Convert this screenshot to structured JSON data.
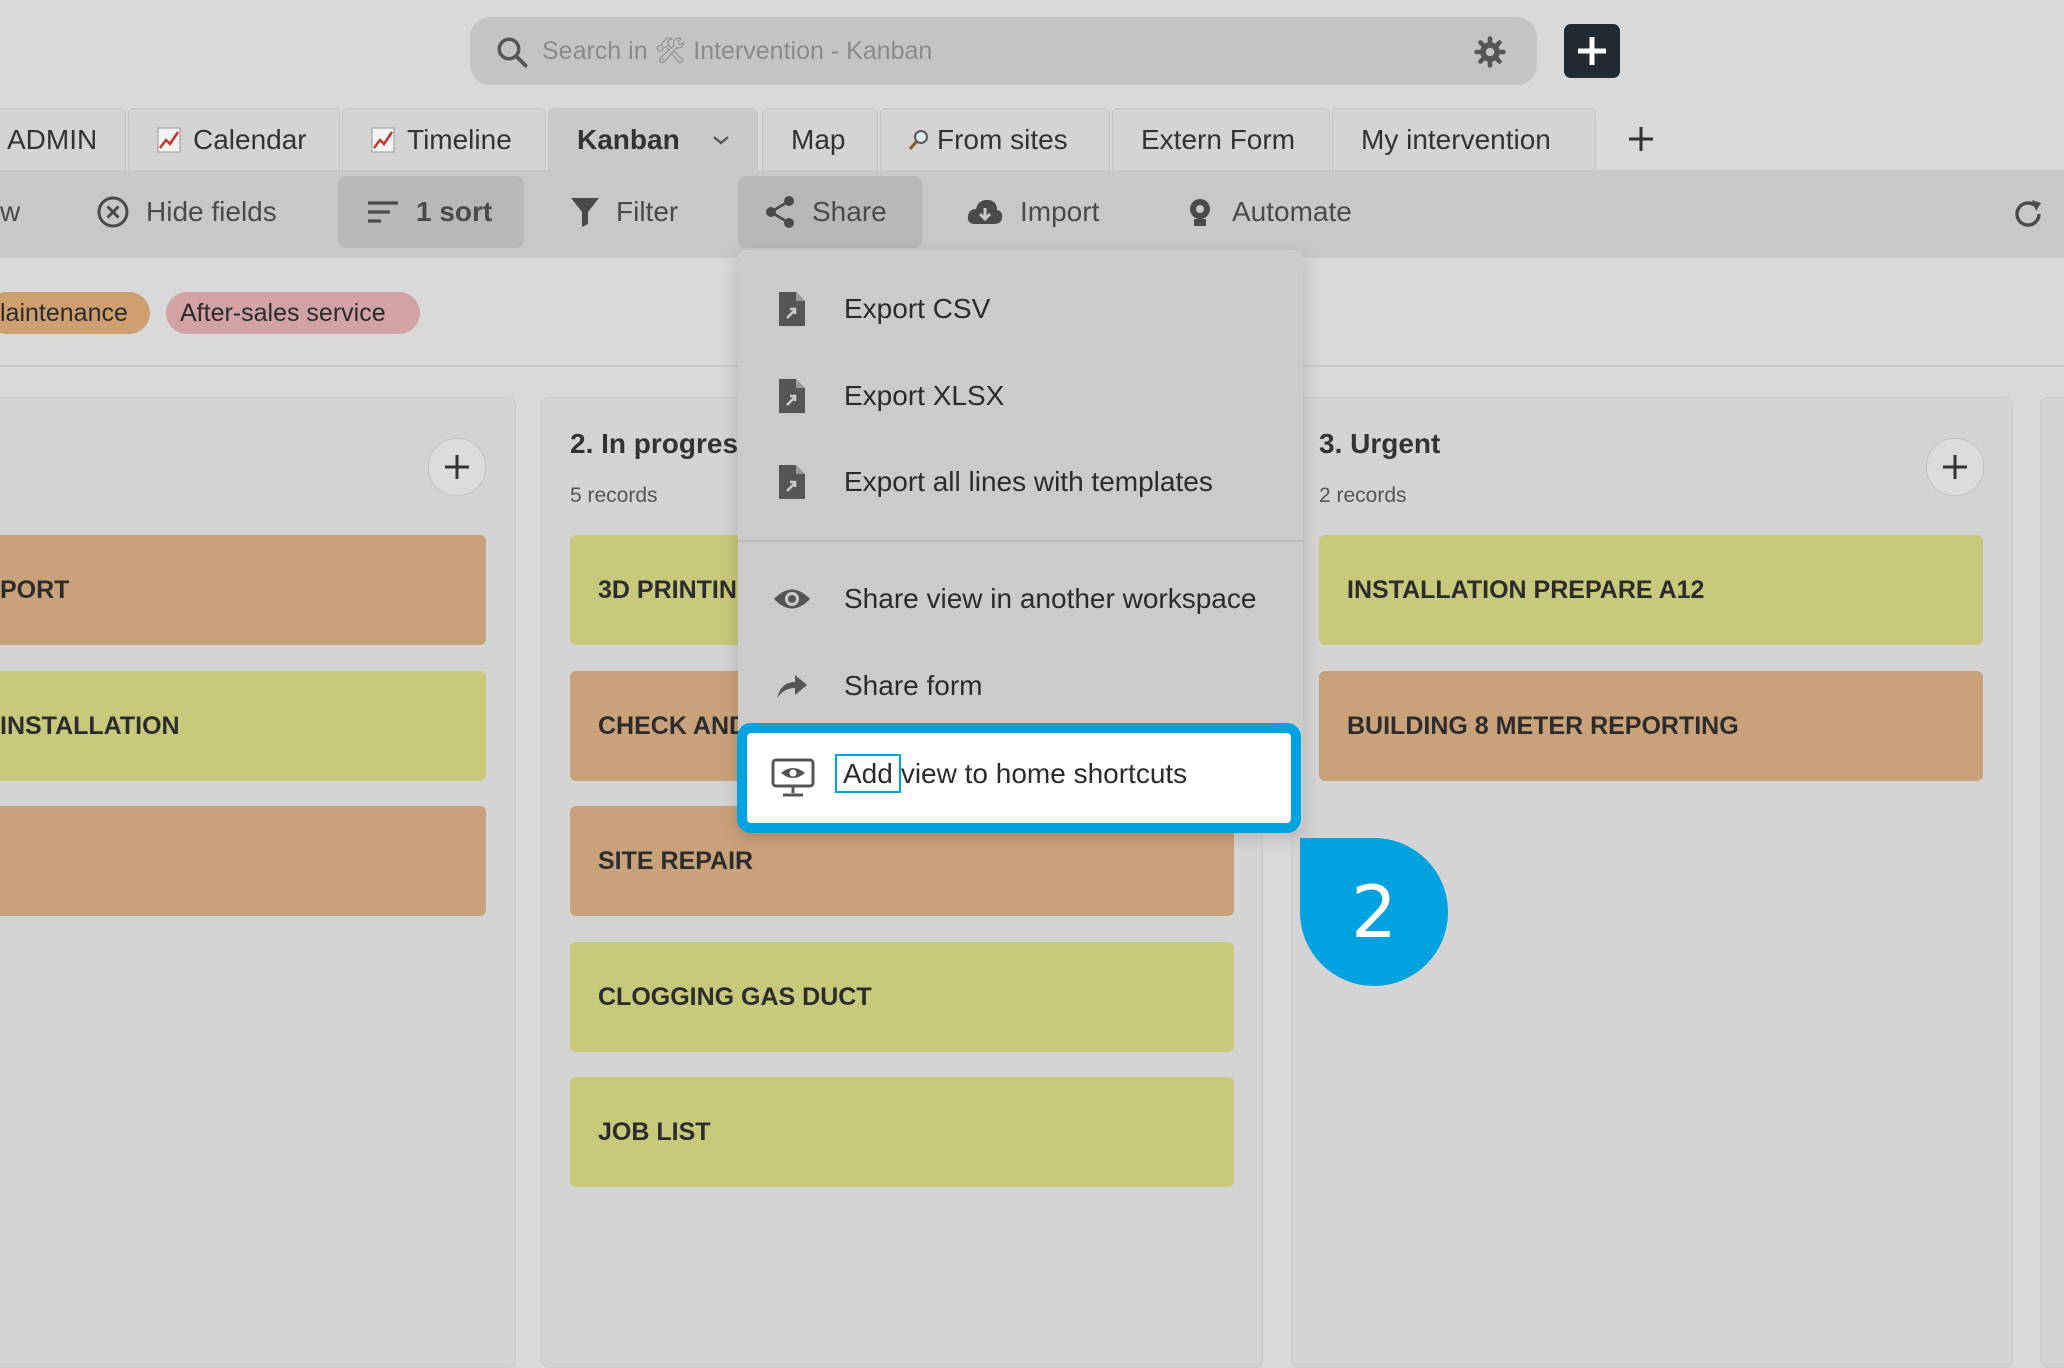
{
  "search": {
    "placeholder": "Search in 🛠 Intervention - Kanban"
  },
  "tabs": [
    {
      "label": "ADMIN"
    },
    {
      "label": "Calendar",
      "icon": "chart-up-icon"
    },
    {
      "label": "Timeline",
      "icon": "chart-up-icon"
    },
    {
      "label": "Kanban",
      "active": true
    },
    {
      "label": "Map"
    },
    {
      "label": "From sites",
      "icon": "magnifier-icon"
    },
    {
      "label": "Extern Form"
    },
    {
      "label": "My intervention"
    }
  ],
  "toolbar": {
    "view_fragment": "w",
    "hide_fields": "Hide fields",
    "sort": "1 sort",
    "filter": "Filter",
    "share": "Share",
    "import": "Import",
    "automate": "Automate"
  },
  "tags": [
    {
      "label": "laintenance",
      "color": "#cfa06f"
    },
    {
      "label": "After-sales service",
      "color": "#d2a3a3"
    }
  ],
  "columns": [
    {
      "title": "",
      "count": "",
      "cards": [
        "PORT",
        "INSTALLATION",
        ""
      ]
    },
    {
      "title": "2. In progres",
      "count": "5 records",
      "cards": [
        "3D PRINTIN",
        "CHECK AND",
        "SITE REPAIR",
        "CLOGGING GAS DUCT",
        "JOB LIST"
      ]
    },
    {
      "title": "3. Urgent",
      "count": "2 records",
      "cards": [
        "INSTALLATION PREPARE A12",
        "BUILDING 8 METER REPORTING"
      ]
    }
  ],
  "share_menu": {
    "items": [
      {
        "label": "Export CSV",
        "icon": "file-export-icon"
      },
      {
        "label": "Export XLSX",
        "icon": "file-export-icon"
      },
      {
        "label": "Export all lines with templates",
        "icon": "file-export-icon"
      },
      {
        "label": "Share view in another workspace",
        "icon": "eye-icon"
      },
      {
        "label": "Share form",
        "icon": "share-arrow-icon"
      }
    ],
    "highlighted": {
      "label_add": "Add",
      "label_rest": "view to home shortcuts",
      "icon": "monitor-eye-icon"
    }
  },
  "step_badge": "2",
  "colors": {
    "accent": "#00a2e0",
    "card_yellow": "#c8c97a",
    "card_orange": "#c9a27a"
  }
}
